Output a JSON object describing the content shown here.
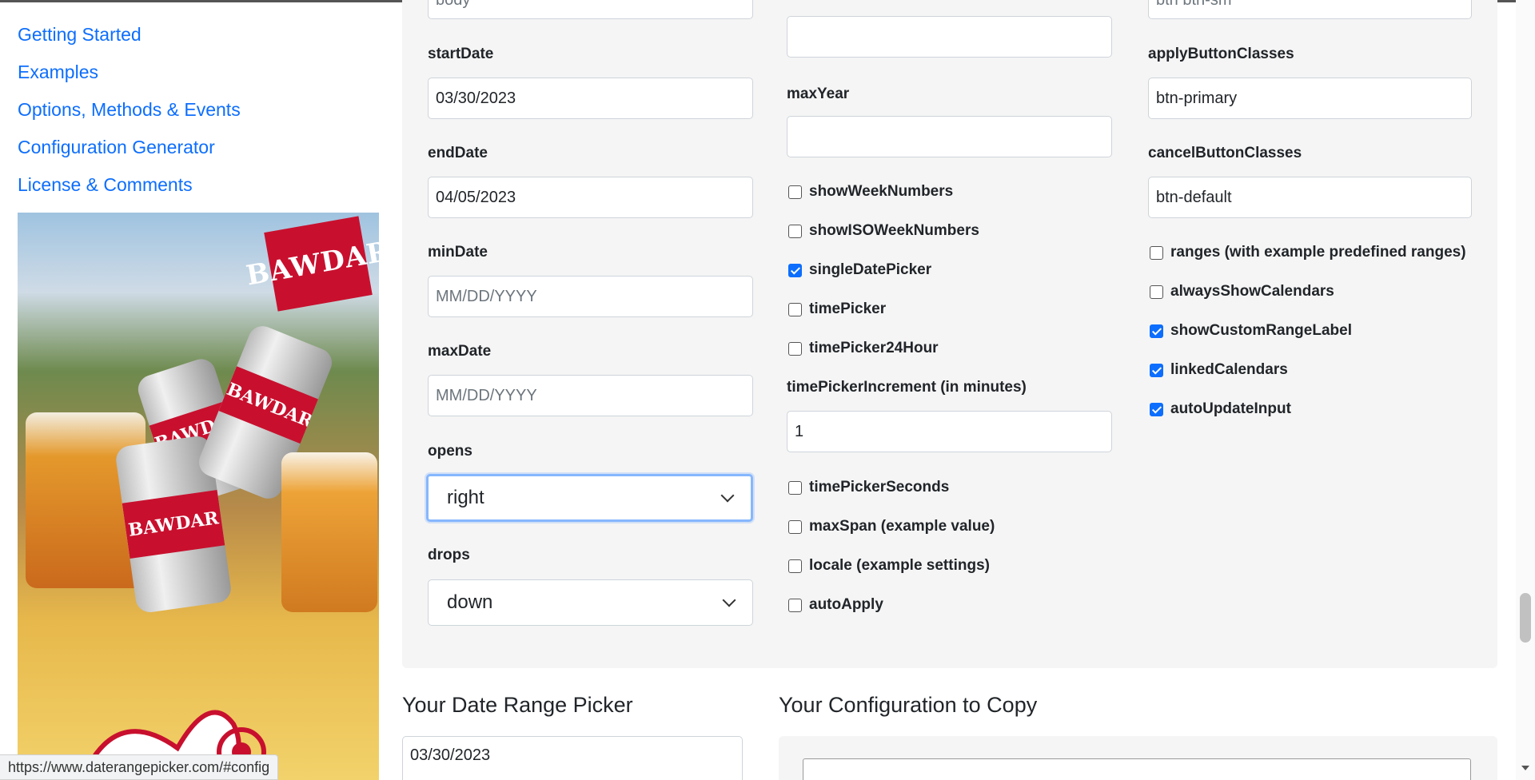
{
  "nav": {
    "items": [
      {
        "label": "Getting Started"
      },
      {
        "label": "Examples"
      },
      {
        "label": "Options, Methods & Events"
      },
      {
        "label": "Configuration Generator"
      },
      {
        "label": "License & Comments"
      }
    ]
  },
  "ad": {
    "brand_logo_text": "BAWDAR",
    "can_text": "BAWDAR"
  },
  "form": {
    "col1": {
      "top_cut_value": "body",
      "startDate": {
        "label": "startDate",
        "value": "03/30/2023"
      },
      "endDate": {
        "label": "endDate",
        "value": "04/05/2023"
      },
      "minDate": {
        "label": "minDate",
        "placeholder": "MM/DD/YYYY"
      },
      "maxDate": {
        "label": "maxDate",
        "placeholder": "MM/DD/YYYY"
      },
      "opens": {
        "label": "opens",
        "value": "right"
      },
      "drops": {
        "label": "drops",
        "value": "down"
      }
    },
    "col2": {
      "maxYear": {
        "label": "maxYear",
        "value": ""
      },
      "checks": [
        {
          "label": "showWeekNumbers",
          "checked": false
        },
        {
          "label": "showISOWeekNumbers",
          "checked": false
        },
        {
          "label": "singleDatePicker",
          "checked": true
        },
        {
          "label": "timePicker",
          "checked": false
        },
        {
          "label": "timePicker24Hour",
          "checked": false
        }
      ],
      "timePickerIncrement": {
        "label": "timePickerIncrement (in minutes)",
        "value": "1"
      },
      "checks2": [
        {
          "label": "timePickerSeconds",
          "checked": false
        },
        {
          "label": "maxSpan (example value)",
          "checked": false
        },
        {
          "label": "locale (example settings)",
          "checked": false
        },
        {
          "label": "autoApply",
          "checked": false
        }
      ]
    },
    "col3": {
      "top_cut_value": "btn btn-sm",
      "applyButtonClasses": {
        "label": "applyButtonClasses",
        "value": "btn-primary"
      },
      "cancelButtonClasses": {
        "label": "cancelButtonClasses",
        "value": "btn-default"
      },
      "checks": [
        {
          "label": "ranges (with example predefined ranges)",
          "checked": false
        },
        {
          "label": "alwaysShowCalendars",
          "checked": false
        },
        {
          "label": "showCustomRangeLabel",
          "checked": true
        },
        {
          "label": "linkedCalendars",
          "checked": true
        },
        {
          "label": "autoUpdateInput",
          "checked": true
        }
      ]
    }
  },
  "picker": {
    "heading": "Your Date Range Picker",
    "value": "03/30/2023"
  },
  "config": {
    "heading": "Your Configuration to Copy"
  },
  "status": {
    "url": "https://www.daterangepicker.com/#config"
  },
  "colors": {
    "link": "#0d6efd",
    "panel": "#f5f5f5",
    "focus": "#86b7fe",
    "check": "#0d6efd"
  }
}
